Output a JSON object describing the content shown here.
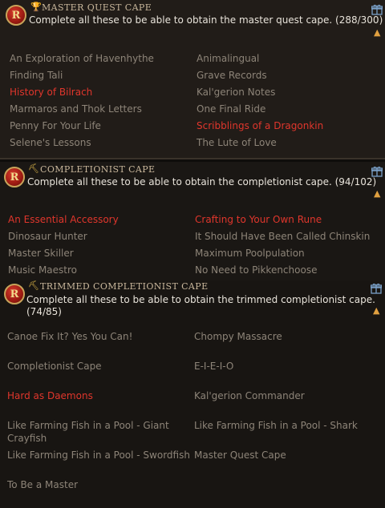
{
  "sections": [
    {
      "title": "MASTER QUEST CAPE",
      "description": "Complete all these to be able to obtain the master quest cape. (288/300)",
      "items": [
        {
          "label": "An Exploration of Havenhythe",
          "color": "#8d8478"
        },
        {
          "label": "Animalingual",
          "color": "#8d8478"
        },
        {
          "label": "Finding Tali",
          "color": "#8d8478"
        },
        {
          "label": "Grave Records",
          "color": "#8d8478"
        },
        {
          "label": "History of Bilrach",
          "color": "#e0362c"
        },
        {
          "label": "Kal'gerion Notes",
          "color": "#8d8478"
        },
        {
          "label": "Marmaros and Thok Letters",
          "color": "#8d8478"
        },
        {
          "label": "One Final Ride",
          "color": "#8d8478"
        },
        {
          "label": "Penny For Your Life",
          "color": "#8d8478"
        },
        {
          "label": "Scribblings of a Dragonkin",
          "color": "#e0362c"
        },
        {
          "label": "Selene's Lessons",
          "color": "#8d8478"
        },
        {
          "label": "The Lute of Love",
          "color": "#8d8478"
        }
      ]
    },
    {
      "title": "COMPLETIONIST CAPE",
      "description": "Complete all these to be able to obtain the completionist cape. (94/102)",
      "items": [
        {
          "label": "An Essential Accessory",
          "color": "#e0362c"
        },
        {
          "label": "Crafting to Your Own Rune",
          "color": "#e0362c"
        },
        {
          "label": "Dinosaur Hunter",
          "color": "#8d8478"
        },
        {
          "label": "It Should Have Been Called Chinskin",
          "color": "#8d8478"
        },
        {
          "label": "Master Skiller",
          "color": "#8d8478"
        },
        {
          "label": "Maximum Poolpulation",
          "color": "#8d8478"
        },
        {
          "label": "Music Maestro",
          "color": "#8d8478"
        },
        {
          "label": "No Need to Pikkenchoose",
          "color": "#8d8478"
        }
      ]
    },
    {
      "title": "TRIMMED COMPLETIONIST CAPE",
      "description_line1": "Complete all these to be able to obtain the trimmed completionist cape.",
      "description_line2": "(74/85)",
      "items": [
        {
          "label": "Canoe Fix It? Yes You Can!",
          "color": "#8d8478"
        },
        {
          "label": "Chompy Massacre",
          "color": "#8d8478"
        },
        {
          "label": "Completionist Cape",
          "color": "#8d8478"
        },
        {
          "label": "E-I-E-I-O",
          "color": "#8d8478"
        },
        {
          "label": "Hard as Daemons",
          "color": "#e0362c"
        },
        {
          "label": "Kal'gerion Commander",
          "color": "#8d8478"
        },
        {
          "label": "Like Farming Fish in a Pool - Giant",
          "label2": "Crayfish",
          "color": "#8d8478"
        },
        {
          "label": "Like Farming Fish in a Pool - Shark",
          "color": "#8d8478"
        },
        {
          "label": "Like Farming Fish in a Pool - Swordfish",
          "color": "#8d8478"
        },
        {
          "label": "Master Quest Cape",
          "color": "#8d8478"
        },
        {
          "label": "To Be a Master",
          "color": "#8d8478"
        }
      ]
    }
  ],
  "icons": {
    "badge_letter": "R",
    "trophy_icon": "trophy-icon",
    "pickaxe_icon": "pickaxe-icon",
    "gift_icon": "gift-icon",
    "chevron_icon": "chevron-up-icon"
  }
}
